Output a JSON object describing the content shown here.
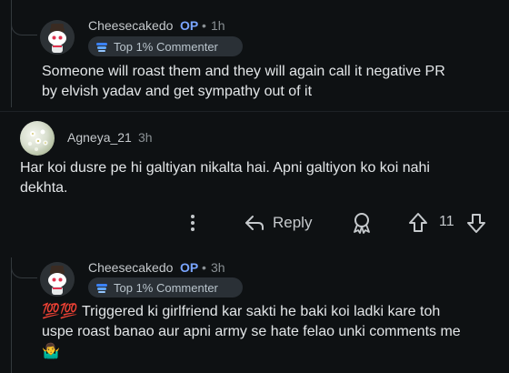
{
  "comments": [
    {
      "username": "Cheesecakedo",
      "op_badge": "OP",
      "separator": "•",
      "time": "1h",
      "flair": "Top 1% Commenter",
      "body_line1": "Someone will roast them and they will again call it negative PR",
      "body_line2": "by elvish yadav and get sympathy out of it"
    },
    {
      "username": "Agneya_21",
      "time": "3h",
      "body_line1": "Har koi dusre pe hi galtiyan nikalta hai. Apni galtiyon ko koi nahi",
      "body_line2": "dekhta."
    },
    {
      "username": "Cheesecakedo",
      "op_badge": "OP",
      "separator": "•",
      "time": "3h",
      "flair": "Top 1% Commenter",
      "body_line1_prefix": "💯💯",
      "body_line1": " Triggered ki girlfriend kar sakti he baki koi ladki kare toh",
      "body_line2": "uspe roast banao aur apni army se hate felao unki comments me",
      "body_line3": "🤷‍♂️"
    }
  ],
  "actions": {
    "more_icon": "more-vertical-icon",
    "reply_label": "Reply",
    "award_icon": "award-icon",
    "upvote_icon": "upvote-arrow-icon",
    "vote_count": "11",
    "downvote_icon": "downvote-arrow-icon"
  },
  "colors": {
    "background": "#0e1113",
    "op_badge": "#7aa5ff",
    "flair_bg": "#2a3036",
    "thread_line": "#33393d"
  }
}
